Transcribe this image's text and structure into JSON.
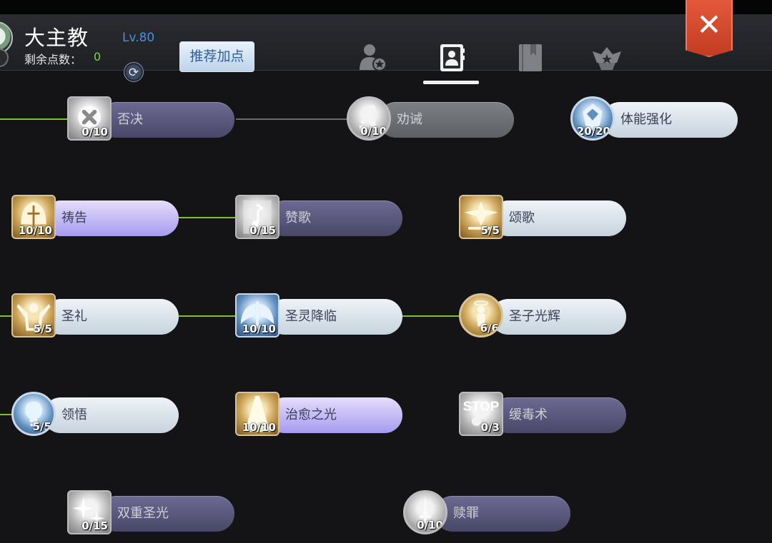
{
  "header": {
    "character_name": "大主教",
    "level": "Lv.80",
    "points_label": "剩余点数：",
    "points_value": "0",
    "recommend_button": "推荐加点",
    "reset_icon": "refresh-icon",
    "close_icon": "close-icon",
    "close_label": "✕",
    "tabs": [
      {
        "icon": "character-icon",
        "active": false
      },
      {
        "icon": "skill-book-icon",
        "active": true
      },
      {
        "icon": "bookmark-book-icon",
        "active": false
      },
      {
        "icon": "honor-badge-icon",
        "active": false
      }
    ]
  },
  "colors": {
    "accent_green": "#7cc22e",
    "level_blue": "#4a8fe0",
    "close_red": "#d24a2e"
  },
  "skills": [
    {
      "name": "否决",
      "level": "0/10",
      "icon": "cross-seal-icon"
    },
    {
      "name": "劝诫",
      "level": "0/10",
      "icon": "kneeling-figure-icon"
    },
    {
      "name": "体能强化",
      "level": "20/20",
      "icon": "shield-helm-icon"
    },
    {
      "name": "祷告",
      "level": "10/10",
      "icon": "prayer-tree-icon"
    },
    {
      "name": "赞歌",
      "level": "0/15",
      "icon": "music-note-icon"
    },
    {
      "name": "颂歌",
      "level": "5/5",
      "icon": "winged-star-icon"
    },
    {
      "name": "圣礼",
      "level": "5/5",
      "icon": "raised-arms-icon"
    },
    {
      "name": "圣灵降临",
      "level": "10/10",
      "icon": "angel-wings-icon"
    },
    {
      "name": "圣子光辉",
      "level": "6/6",
      "icon": "halo-child-icon"
    },
    {
      "name": "领悟",
      "level": "5/5",
      "icon": "lightbulb-icon"
    },
    {
      "name": "治愈之光",
      "level": "10/10",
      "icon": "light-beam-icon"
    },
    {
      "name": "缓毒术",
      "level": "0/3",
      "icon": "stop-skull-icon",
      "icon_text": "STOP"
    },
    {
      "name": "双重圣光",
      "level": "0/15",
      "icon": "sparkle-icon"
    },
    {
      "name": "赎罪",
      "level": "0/10",
      "icon": "dagger-icon"
    }
  ]
}
